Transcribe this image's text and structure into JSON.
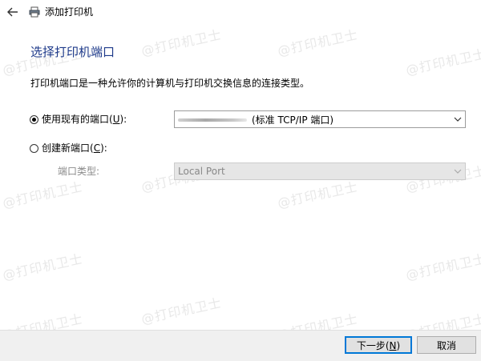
{
  "window": {
    "title": "添加打印机"
  },
  "heading": "选择打印机端口",
  "description": "打印机端口是一种允许你的计算机与打印机交换信息的连接类型。",
  "options": {
    "existing": {
      "label_prefix": "使用现有的端口(",
      "mnemonic": "U",
      "label_suffix": "):",
      "selected": true,
      "value": "(标准 TCP/IP 端口)"
    },
    "new": {
      "label_prefix": "创建新端口(",
      "mnemonic": "C",
      "label_suffix": "):",
      "selected": false,
      "port_type_label": "端口类型:",
      "port_type_value": "Local Port"
    }
  },
  "buttons": {
    "next_prefix": "下一步(",
    "next_mnemonic": "N",
    "next_suffix": ")",
    "cancel": "取消"
  },
  "watermark": "@打印机卫士",
  "icons": {
    "back": "back-arrow-icon",
    "printer": "printer-icon",
    "dropdown": "chevron-down-icon"
  },
  "colors": {
    "heading": "#1e3a8a",
    "primary_border": "#0078d7",
    "footer": "#f0f0f0"
  }
}
